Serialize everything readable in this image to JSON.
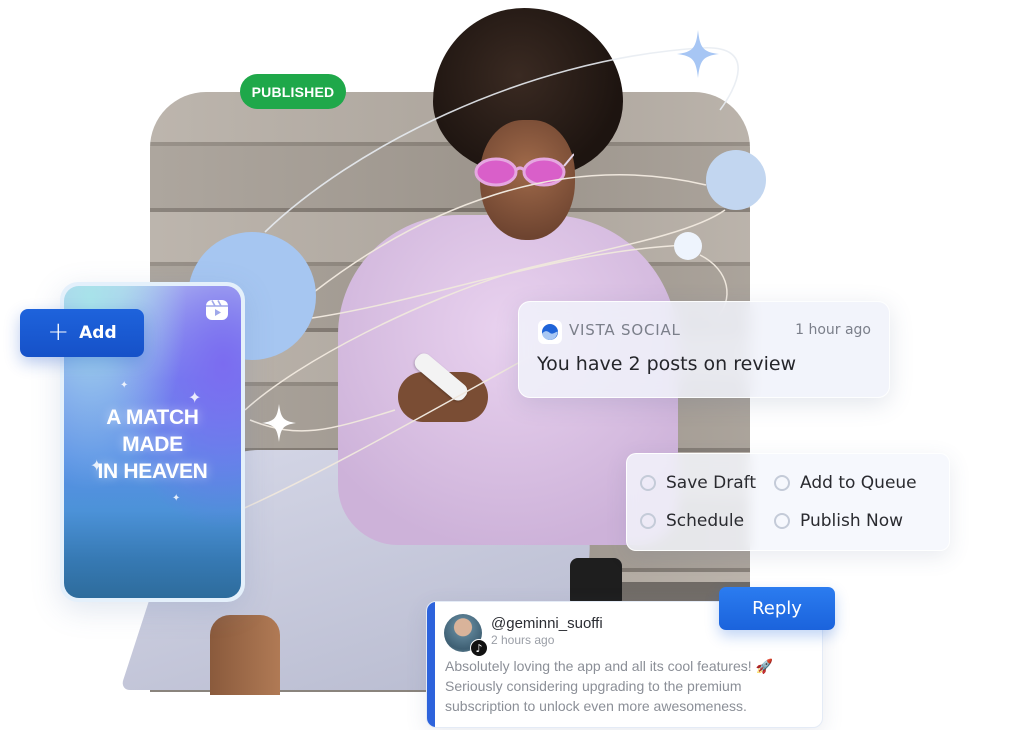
{
  "badge": {
    "label": "PUBLISHED",
    "color": "#1fa84a"
  },
  "reel_card": {
    "icon": "instagram-reels-icon",
    "headline_lines": [
      "A MATCH",
      "MADE",
      "IN HEAVEN"
    ]
  },
  "add_button": {
    "icon": "plus-icon",
    "label": "Add"
  },
  "notification": {
    "app_icon": "vista-social-logo",
    "app_name": "VISTA SOCIAL",
    "time": "1 hour ago",
    "message": "You have 2 posts on review"
  },
  "publish_options": [
    {
      "label": "Save Draft",
      "selected": false
    },
    {
      "label": "Add to Queue",
      "selected": false
    },
    {
      "label": "Schedule",
      "selected": false
    },
    {
      "label": "Publish Now",
      "selected": false
    }
  ],
  "comment": {
    "platform_icon": "tiktok-icon",
    "username": "@geminni_suoffi",
    "time": "2 hours ago",
    "text": "Absolutely loving the app and all its cool features! 🚀 Seriously considering upgrading to the premium subscription to unlock even more awesomeness."
  },
  "reply_button": {
    "label": "Reply"
  },
  "colors": {
    "primary_blue": "#1b63dc",
    "accent_light_blue": "#a6c6f1",
    "success_green": "#1fa84a"
  }
}
